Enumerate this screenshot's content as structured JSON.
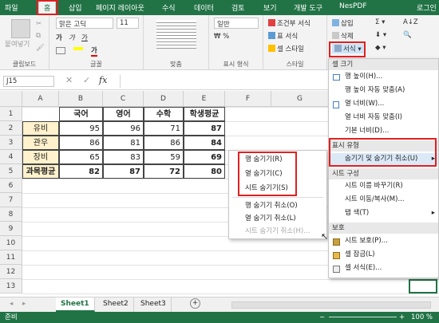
{
  "ribbon_tabs": [
    "파일",
    "홈",
    "삽입",
    "페이지 레이아웃",
    "수식",
    "데이터",
    "검토",
    "보기",
    "개발 도구",
    "NesPDF",
    "로그인"
  ],
  "ribbon": {
    "clipboard": {
      "paste": "붙여넣기",
      "label": "클립보드"
    },
    "font": {
      "name": "맑은 고딕",
      "size": "11",
      "label": "글꼴",
      "bold": "가",
      "italic": "가",
      "underline": "가"
    },
    "align": {
      "label": "맞춤"
    },
    "number": {
      "format": "일반",
      "label": "표시 형식"
    },
    "style": {
      "cond": "조건부 서식",
      "table": "표 서식",
      "cell": "셀 스타일",
      "label": "스타일"
    },
    "cells": {
      "insert": "삽입",
      "delete": "삭제",
      "format": "서식"
    }
  },
  "formula_bar": {
    "namebox": "J15",
    "fx": "fx"
  },
  "columns": [
    "A",
    "B",
    "C",
    "D",
    "E",
    "F",
    "G"
  ],
  "rows": [
    "1",
    "2",
    "3",
    "4",
    "5",
    "6",
    "7",
    "8",
    "9",
    "10",
    "11",
    "12",
    "13",
    "14",
    "15"
  ],
  "table": {
    "headers": [
      "국어",
      "영어",
      "수학",
      "학생평균"
    ],
    "data": [
      {
        "name": "유비",
        "vals": [
          "95",
          "96",
          "71",
          "87"
        ]
      },
      {
        "name": "관우",
        "vals": [
          "86",
          "81",
          "86",
          "84"
        ]
      },
      {
        "name": "장비",
        "vals": [
          "65",
          "83",
          "59",
          "69"
        ]
      }
    ],
    "avg": {
      "name": "과목평균",
      "vals": [
        "82",
        "87",
        "72",
        "80"
      ]
    }
  },
  "format_menu": {
    "sec_size": "셀 크기",
    "row_height": "행 높이(H)...",
    "row_autofit": "행 높이 자동 맞춤(A)",
    "col_width": "열 너비(W)...",
    "col_autofit": "열 너비 자동 맞춤(I)",
    "default_width": "기본 너비(D)...",
    "sec_visibility": "표시 유형",
    "hide_unhide": "숨기기 및 숨기기 취소(U)",
    "sec_organize": "시트 구성",
    "rename": "시트 이름 바꾸기(R)",
    "move_copy": "시트 이동/복사(M)...",
    "tab_color": "탭 색(T)",
    "sec_protect": "보호",
    "protect_sheet": "시트 보호(P)...",
    "lock_cell": "셀 잠금(L)",
    "format_cells": "셀 서식(E)..."
  },
  "hide_submenu": {
    "hide_rows": "행 숨기기(R)",
    "hide_cols": "열 숨기기(C)",
    "hide_sheet": "시트 숨기기(S)",
    "unhide_rows": "행 숨기기 취소(O)",
    "unhide_cols": "열 숨기기 취소(L)",
    "unhide_sheet": "시트 숨기기 취소(H)..."
  },
  "sheets": [
    "Sheet1",
    "Sheet2",
    "Sheet3"
  ],
  "status": {
    "ready": "준비",
    "zoom": "100 %"
  },
  "colors": {
    "excel_green": "#217346",
    "highlight_red": "#e02020",
    "yellow_fill": "#fff2cc"
  }
}
